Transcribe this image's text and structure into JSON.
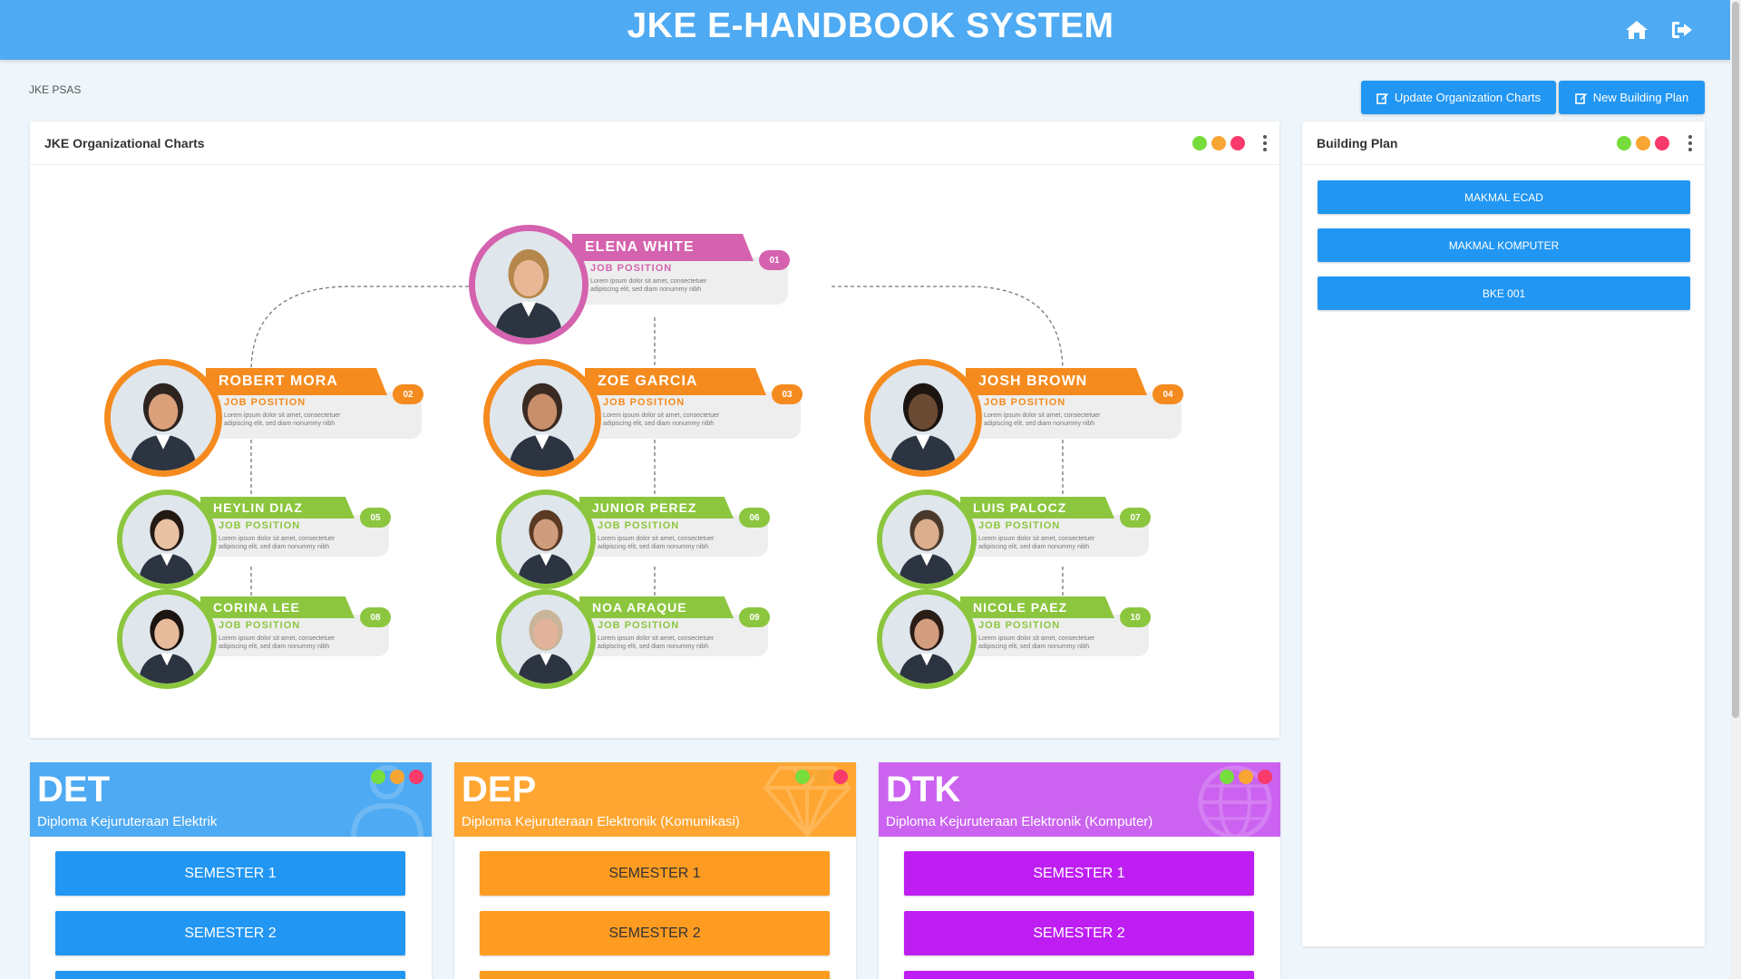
{
  "header": {
    "title": "JKE E-HANDBOOK SYSTEM",
    "home_icon": "home-icon",
    "logout_icon": "sign-out-icon"
  },
  "breadcrumb": "JKE PSAS",
  "actions": {
    "update_org": "Update Organization Charts",
    "new_plan": "New Building Plan"
  },
  "status_dots": [
    "#76dd3c",
    "#f7a533",
    "#f83a6c"
  ],
  "org_chart": {
    "title": "JKE Organizational Charts",
    "job_position": "JOB POSITION",
    "desc_line1": "Lorem ipsum dolor sit amet, consectetuer",
    "desc_line2": "adipiscing elit, sed diam nonummy nibh",
    "colors": {
      "top": "#d462ae",
      "mid": "#f58b1f",
      "low": "#8cc63f"
    },
    "people": [
      {
        "name": "ELENA WHITE",
        "num": "01"
      },
      {
        "name": "ROBERT MORA",
        "num": "02"
      },
      {
        "name": "ZOE GARCIA",
        "num": "03"
      },
      {
        "name": "JOSH BROWN",
        "num": "04"
      },
      {
        "name": "HEYLIN DIAZ",
        "num": "05"
      },
      {
        "name": "JUNIOR PEREZ",
        "num": "06"
      },
      {
        "name": "LUIS PALOCZ",
        "num": "07"
      },
      {
        "name": "CORINA LEE",
        "num": "08"
      },
      {
        "name": "NOA ARAQUE",
        "num": "09"
      },
      {
        "name": "NICOLE PAEZ",
        "num": "10"
      }
    ]
  },
  "building_plan": {
    "title": "Building Plan",
    "items": [
      "MAKMAL ECAD",
      "MAKMAL KOMPUTER",
      "BKE 001"
    ]
  },
  "departments": [
    {
      "code": "DET",
      "name": "Diploma Kejuruteraan Elektrik",
      "color": "#4eaaf2",
      "btn": "#2196f3",
      "btn_text": "#ffffff",
      "bg_icon": "user-icon",
      "semesters": [
        "SEMESTER 1",
        "SEMESTER 2"
      ]
    },
    {
      "code": "DEP",
      "name": "Diploma Kejuruteraan Elektronik (Komunikasi)",
      "color": "#fea631",
      "btn": "#fe9c22",
      "btn_text": "#333333",
      "bg_icon": "diamond-icon",
      "semesters": [
        "SEMESTER 1",
        "SEMESTER 2"
      ]
    },
    {
      "code": "DTK",
      "name": "Diploma Kejuruteraan Elektronik (Komputer)",
      "color": "#cb63f0",
      "btn": "#be1ef2",
      "btn_text": "#ffffff",
      "bg_icon": "globe-icon",
      "semesters": [
        "SEMESTER 1",
        "SEMESTER 2"
      ]
    }
  ]
}
